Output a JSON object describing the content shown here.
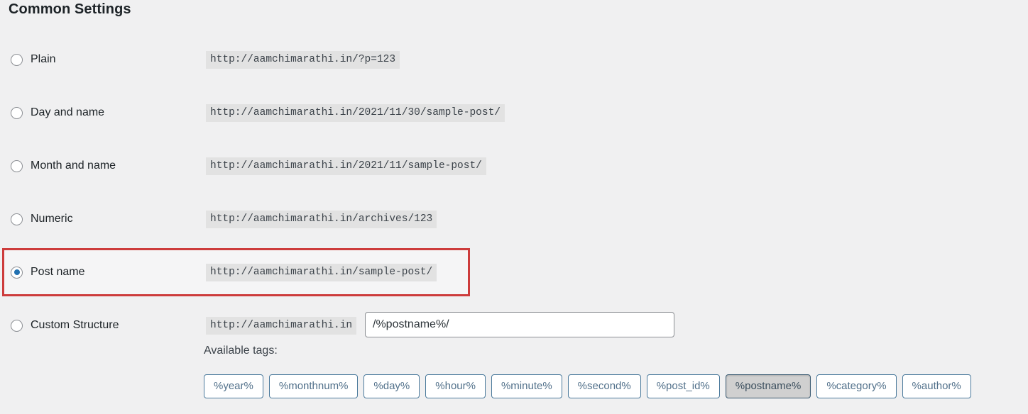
{
  "page": {
    "title": "Common Settings"
  },
  "options": [
    {
      "id": "plain",
      "label": "Plain",
      "example": "http://aamchimarathi.in/?p=123",
      "selected": false,
      "highlighted": false
    },
    {
      "id": "day-and-name",
      "label": "Day and name",
      "example": "http://aamchimarathi.in/2021/11/30/sample-post/",
      "selected": false,
      "highlighted": false
    },
    {
      "id": "month-and-name",
      "label": "Month and name",
      "example": "http://aamchimarathi.in/2021/11/sample-post/",
      "selected": false,
      "highlighted": false
    },
    {
      "id": "numeric",
      "label": "Numeric",
      "example": "http://aamchimarathi.in/archives/123",
      "selected": false,
      "highlighted": false
    },
    {
      "id": "post-name",
      "label": "Post name",
      "example": "http://aamchimarathi.in/sample-post/",
      "selected": true,
      "highlighted": true
    },
    {
      "id": "custom-structure",
      "label": "Custom Structure",
      "example": "http://aamchimarathi.in",
      "selected": false,
      "highlighted": false
    }
  ],
  "custom_structure": {
    "prefix": "http://aamchimarathi.in",
    "value": "/%postname%/",
    "placeholder": ""
  },
  "available_tags": {
    "label": "Available tags:",
    "tags": [
      {
        "label": "%year%",
        "active": false
      },
      {
        "label": "%monthnum%",
        "active": false
      },
      {
        "label": "%day%",
        "active": false
      },
      {
        "label": "%hour%",
        "active": false
      },
      {
        "label": "%minute%",
        "active": false
      },
      {
        "label": "%second%",
        "active": false
      },
      {
        "label": "%post_id%",
        "active": false
      },
      {
        "label": "%postname%",
        "active": true
      },
      {
        "label": "%category%",
        "active": false
      },
      {
        "label": "%author%",
        "active": false
      }
    ]
  },
  "colors": {
    "background": "#f0f0f1",
    "highlight_border": "#cd3c3c",
    "radio_accent": "#2271b1",
    "code_background": "#e2e2e2",
    "tag_border": "#4b7a9c",
    "tag_active_background": "#d0d0d0"
  },
  "layout": {
    "row_tops": [
      64,
      139,
      214,
      289,
      364,
      439
    ],
    "code_lefts": [
      290,
      290,
      290,
      290,
      290,
      290
    ],
    "code_tops": [
      72,
      147,
      222,
      297,
      372,
      447
    ]
  }
}
